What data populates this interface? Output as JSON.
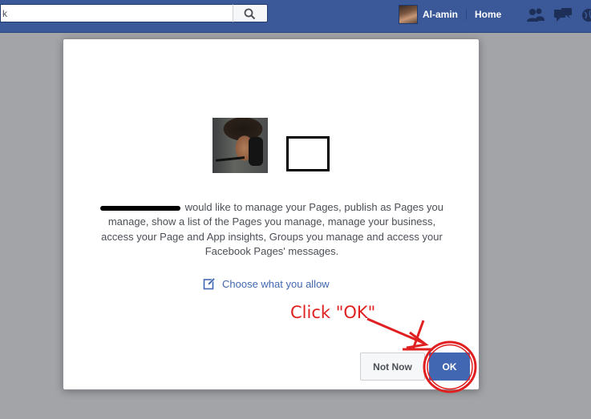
{
  "header": {
    "search_value": "k",
    "profile_name": "Al-amin",
    "home_label": "Home",
    "icons": [
      "search-icon",
      "friend-requests-icon",
      "messages-icon",
      "notifications-globe-icon"
    ]
  },
  "dialog": {
    "permission_text": "would like to manage your Pages, publish as Pages you manage, show a list of the Pages you manage, manage your business, access your Page and App insights, Groups you manage and access your Facebook Pages' messages.",
    "choose_link": "Choose what you allow",
    "not_now_label": "Not Now",
    "ok_label": "OK"
  },
  "annotation": {
    "text": "Click \"OK\"",
    "color": "#e02020"
  },
  "colors": {
    "brand_blue": "#3b5998",
    "button_blue": "#4267b2",
    "overlay_gray": "#a2a4a8"
  }
}
